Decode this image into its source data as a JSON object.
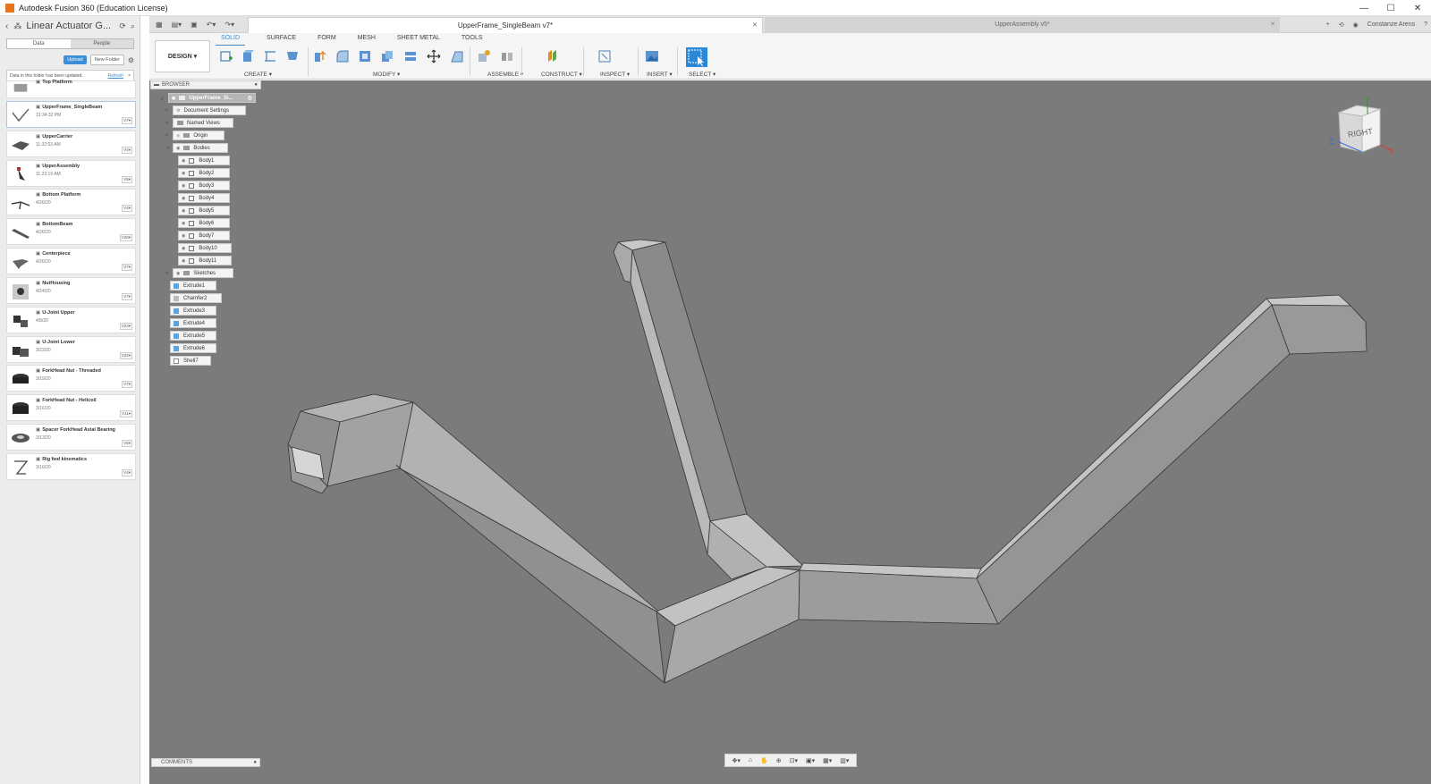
{
  "window": {
    "title": "Autodesk Fusion 360 (Education License)",
    "controls": [
      "—",
      "☐",
      "✕"
    ]
  },
  "data_panel": {
    "project": "Linear Actuator G...",
    "tabs": [
      "Data",
      "People"
    ],
    "upload_label": "Upload",
    "new_folder_label": "New Folder",
    "notice": {
      "message": "Data in this folder has been updated.",
      "refresh": "Refresh",
      "close": "×"
    },
    "files": [
      {
        "name": "Top Platform",
        "date": "",
        "version": ""
      },
      {
        "name": "UpperFrame_SingleBeam",
        "date": "12:34:32 PM",
        "version": "V7▾"
      },
      {
        "name": "UpperCarrier",
        "date": "11:32:03 AM",
        "version": "V4▾"
      },
      {
        "name": "UpperAssembly",
        "date": "11:23:19 AM",
        "version": "V5▾"
      },
      {
        "name": "Bottom Platform",
        "date": "4/26/20",
        "version": "V4▾"
      },
      {
        "name": "BottomBeam",
        "date": "4/26/20",
        "version": "V20▾"
      },
      {
        "name": "Centerpiece",
        "date": "4/26/20",
        "version": "V7▾"
      },
      {
        "name": "NutHousing",
        "date": "4/24/20",
        "version": "V7▾"
      },
      {
        "name": "U-Joint Upper",
        "date": "4/8/20",
        "version": "V24▾"
      },
      {
        "name": "U-Joint Lower",
        "date": "3/22/20",
        "version": "V32▾"
      },
      {
        "name": "ForkHead Nut - Threaded",
        "date": "3/19/20",
        "version": "V7▾"
      },
      {
        "name": "ForkHead Nut - Helicoil",
        "date": "3/16/20",
        "version": "V11▾"
      },
      {
        "name": "Spacer ForkHead Axial Bearing",
        "date": "3/13/20",
        "version": "V6▾"
      },
      {
        "name": "Rig fwd kinematics",
        "date": "3/16/20",
        "version": "V4▾"
      }
    ]
  },
  "doc_tabs": {
    "active": "UpperFrame_SingleBeam v7*",
    "inactive": "UpperAssembly v5*",
    "user": "Constanze Arens"
  },
  "toolbar": {
    "workspace": "DESIGN ▾",
    "ribbon_tabs": [
      "SOLID",
      "SURFACE",
      "FORM",
      "MESH",
      "SHEET METAL",
      "TOOLS"
    ],
    "groups": [
      "CREATE ▾",
      "MODIFY ▾",
      "ASSEMBLE ▾",
      "CONSTRUCT ▾",
      "INSPECT ▾",
      "INSERT ▾",
      "SELECT ▾"
    ]
  },
  "browser": {
    "header": "BROWSER",
    "root": "UpperFrame_Si...",
    "document_settings": "Document Settings",
    "named_views": "Named Views",
    "origin": "Origin",
    "bodies_folder": "Bodies",
    "bodies": [
      "Body1",
      "Body2",
      "Body3",
      "Body4",
      "Body5",
      "Body6",
      "Body7",
      "Body10",
      "Body11"
    ],
    "sketches": "Sketches",
    "timeline": [
      "Extrude1",
      "Chamfer2",
      "Extrude3",
      "Extrude4",
      "Extrude5",
      "Extrude6",
      "Shell7"
    ]
  },
  "viewcube": {
    "face": "RIGHT",
    "y_label": "Y",
    "z_label": "Z",
    "x_label": "X"
  },
  "comments": {
    "label": "COMMENTS"
  },
  "colors": {
    "accent": "#3a8fd6",
    "canvas": "#7b7b7b",
    "select_button": "#2b88d8"
  }
}
